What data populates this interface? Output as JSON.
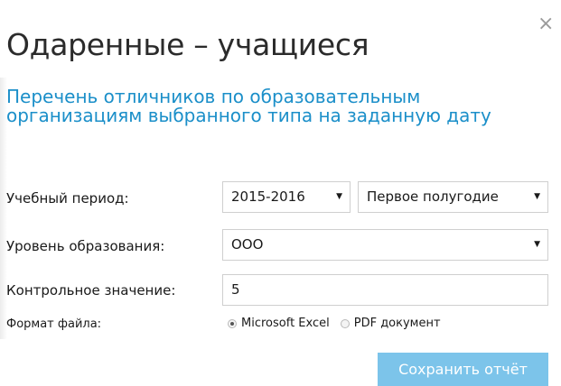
{
  "dialog": {
    "close_glyph": "×",
    "title": "Одаренные – учащиеся",
    "subtitle": "Перечень отличников по образовательным организациям выбранного типа на заданную дату"
  },
  "form": {
    "period_label": "Учебный период:",
    "period_year": "2015-2016",
    "period_term": "Первое полугодие",
    "level_label": "Уровень образования:",
    "level_value": "ООО",
    "control_label": "Контрольное значение:",
    "control_value": "5",
    "format_label": "Формат файла:",
    "format_options": [
      {
        "label": "Microsoft Excel",
        "checked": true
      },
      {
        "label": "PDF документ",
        "checked": false
      }
    ],
    "save_label": "Сохранить отчёт"
  },
  "icons": {
    "caret": "▼",
    "close": "close-icon"
  },
  "colors": {
    "subtitle": "#1b8fc9",
    "button_bg": "#7cc4ea",
    "button_text": "#ffffff"
  }
}
